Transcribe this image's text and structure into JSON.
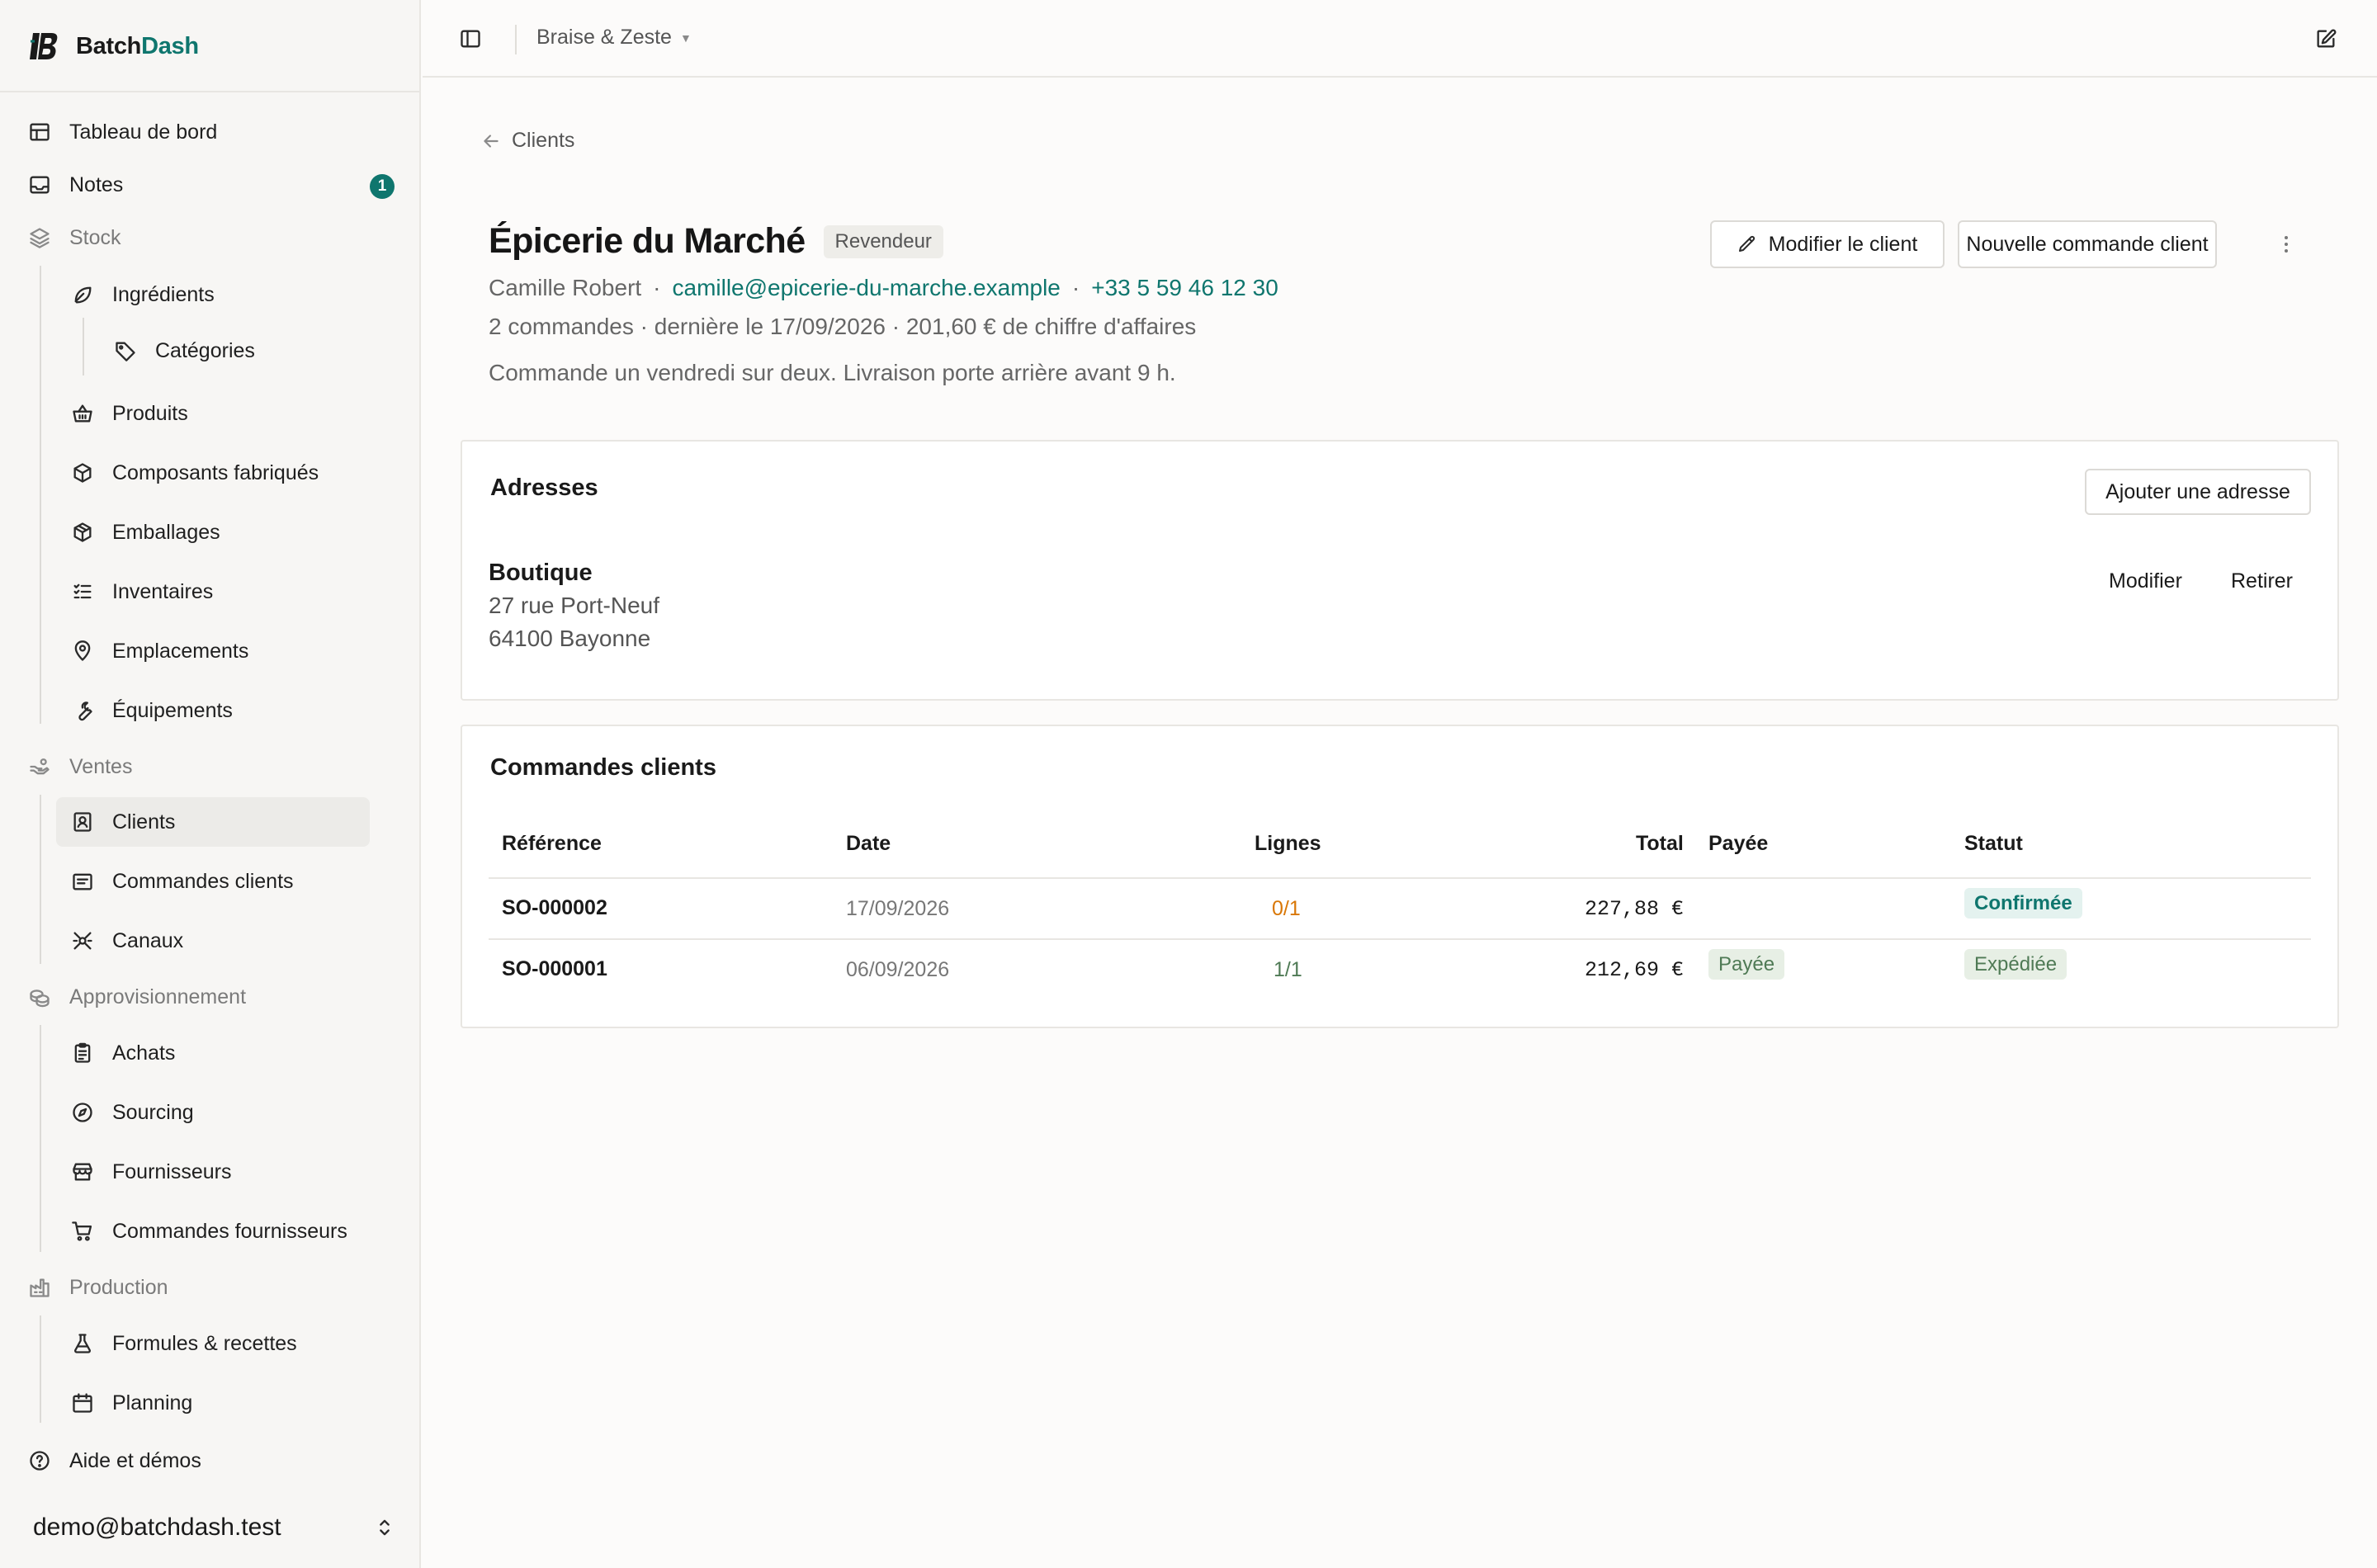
{
  "brand": {
    "name_part1": "Batch",
    "name_part2": "Dash"
  },
  "sidebar": {
    "items": [
      {
        "label": "Tableau de bord"
      },
      {
        "label": "Notes",
        "badge": "1"
      },
      {
        "label": "Stock"
      },
      {
        "label": "Ingrédients"
      },
      {
        "label": "Catégories"
      },
      {
        "label": "Produits"
      },
      {
        "label": "Composants fabriqués"
      },
      {
        "label": "Emballages"
      },
      {
        "label": "Inventaires"
      },
      {
        "label": "Emplacements"
      },
      {
        "label": "Équipements"
      },
      {
        "label": "Ventes"
      },
      {
        "label": "Clients"
      },
      {
        "label": "Commandes clients"
      },
      {
        "label": "Canaux"
      },
      {
        "label": "Approvisionnement"
      },
      {
        "label": "Achats"
      },
      {
        "label": "Sourcing"
      },
      {
        "label": "Fournisseurs"
      },
      {
        "label": "Commandes fournisseurs"
      },
      {
        "label": "Production"
      },
      {
        "label": "Formules & recettes"
      },
      {
        "label": "Planning"
      },
      {
        "label": "Aide et démos"
      }
    ],
    "user_email": "demo@batchdash.test"
  },
  "topbar": {
    "org_name": "Braise & Zeste"
  },
  "breadcrumb": {
    "back_label": "Clients"
  },
  "client": {
    "name": "Épicerie du Marché",
    "type_tag": "Revendeur",
    "contact_name": "Camille Robert",
    "separator": "·",
    "email": "camille@epicerie-du-marche.example",
    "phone": "+33 5 59 46 12 30",
    "stats": "2 commandes · dernière le 17/09/2026 · 201,60 € de chiffre d'affaires",
    "note": "Commande un vendredi sur deux. Livraison porte arrière avant 9 h."
  },
  "actions": {
    "edit_client": "Modifier le client",
    "new_order": "Nouvelle commande client"
  },
  "addresses": {
    "title": "Adresses",
    "add_label": "Ajouter une adresse",
    "items": [
      {
        "name": "Boutique",
        "line1": "27 rue Port-Neuf",
        "line2": "64100 Bayonne",
        "modify": "Modifier",
        "remove": "Retirer"
      }
    ]
  },
  "orders": {
    "title": "Commandes clients",
    "columns": {
      "ref": "Référence",
      "date": "Date",
      "lines": "Lignes",
      "total": "Total",
      "paid": "Payée",
      "status": "Statut"
    },
    "rows": [
      {
        "ref": "SO-000002",
        "date": "17/09/2026",
        "lines": "0/1",
        "total": "227,88 €",
        "paid": "",
        "status": "Confirmée"
      },
      {
        "ref": "SO-000001",
        "date": "06/09/2026",
        "lines": "1/1",
        "total": "212,69 €",
        "paid": "Payée",
        "status": "Expédiée"
      }
    ]
  },
  "colors": {
    "accent": "#0f766e",
    "lines_incomplete": "#d97706",
    "lines_complete": "#4f7a55"
  }
}
